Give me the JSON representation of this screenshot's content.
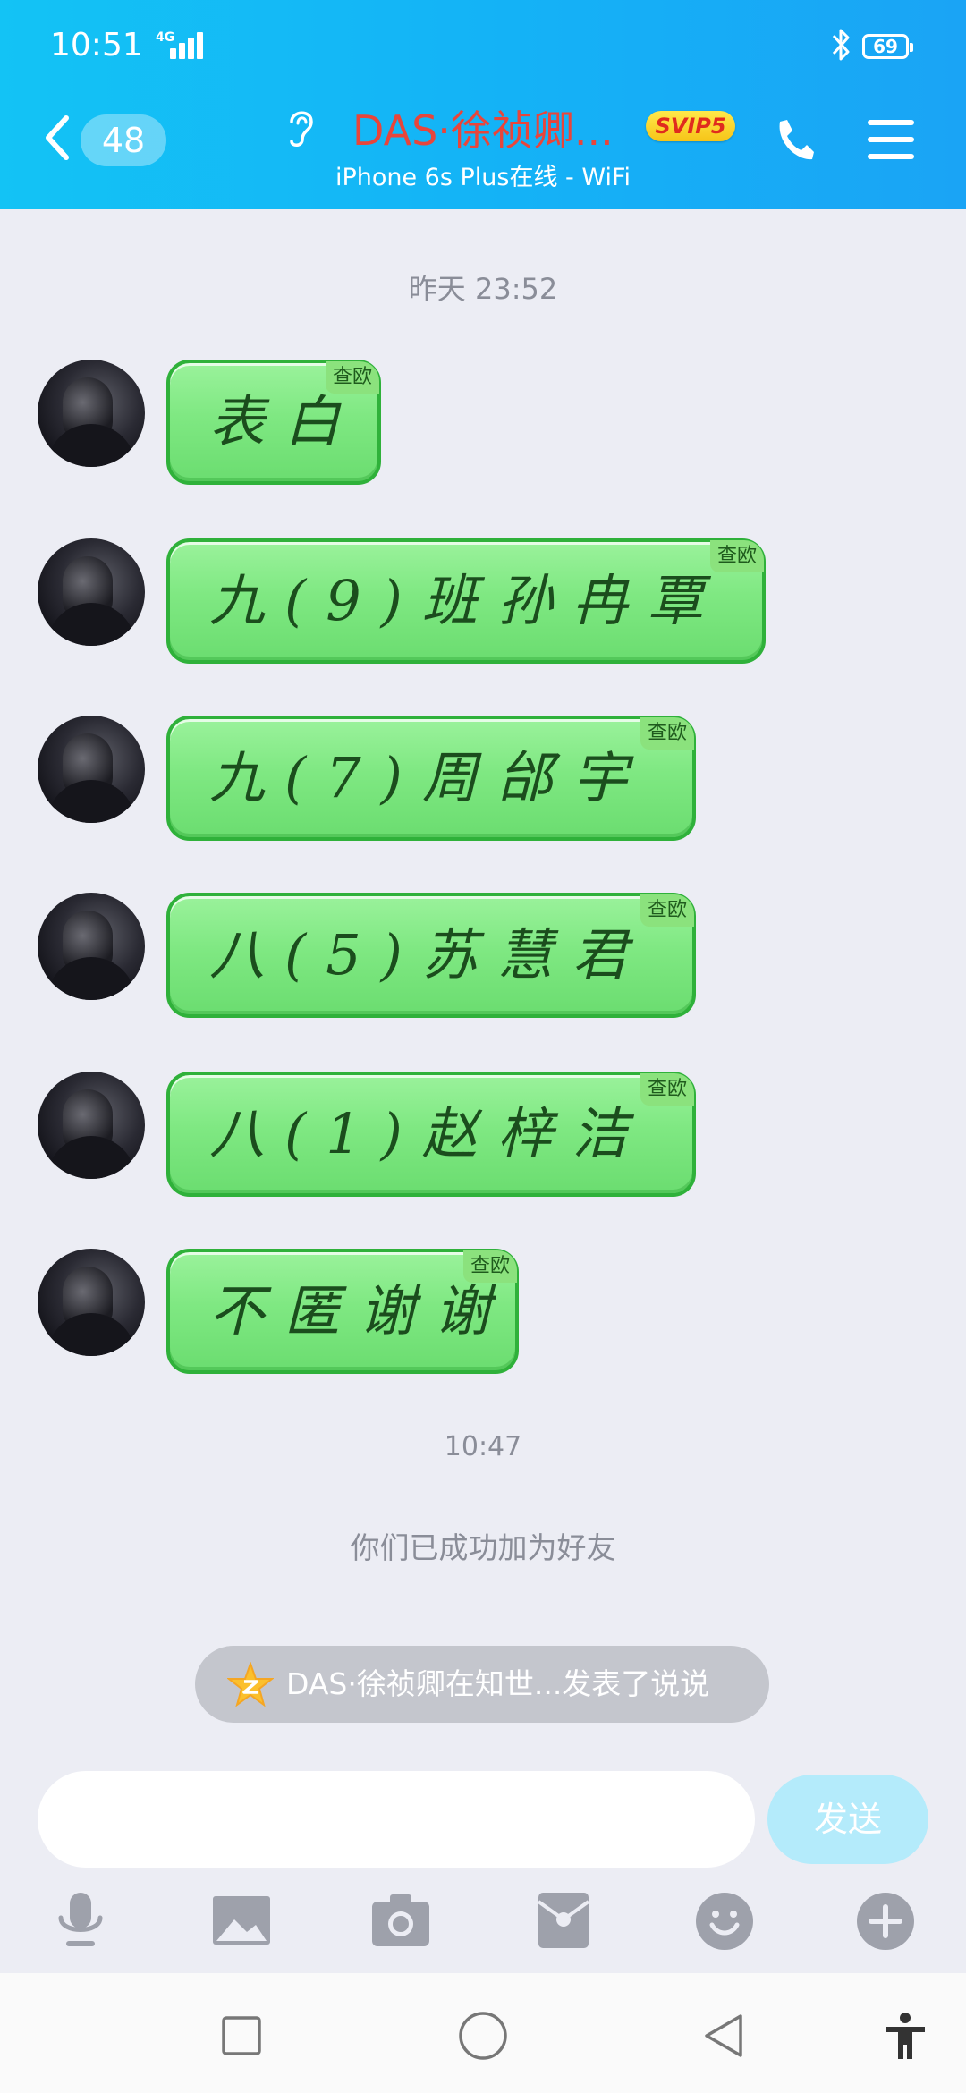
{
  "status_bar": {
    "time": "10:51",
    "network": "4G",
    "battery": "69"
  },
  "header": {
    "unread_count": "48",
    "chat_name": "DAS·徐祯卿...",
    "vip_badge": "SVIP5",
    "status": "iPhone 6s Plus在线 - WiFi"
  },
  "messages": {
    "timestamp_1": "昨天 23:52",
    "tag": "查欧",
    "items": [
      {
        "text": "表白"
      },
      {
        "text": "九(9)班孙冉覃"
      },
      {
        "text": "九(7)周邰宇"
      },
      {
        "text": "八(5)苏慧君"
      },
      {
        "text": "八(1)赵梓洁"
      },
      {
        "text": "不匿谢谢"
      }
    ],
    "timestamp_2": "10:47",
    "system": "你们已成功加为好友"
  },
  "notification": {
    "text": "DAS·徐祯卿在知世...发表了说说"
  },
  "input": {
    "send_label": "发送"
  },
  "icons": {
    "toolbar": [
      "microphone-icon",
      "image-icon",
      "camera-icon",
      "red-packet-icon",
      "emoji-icon",
      "plus-icon"
    ],
    "nav": [
      "recent-apps-icon",
      "home-icon",
      "back-icon",
      "accessibility-icon"
    ]
  }
}
